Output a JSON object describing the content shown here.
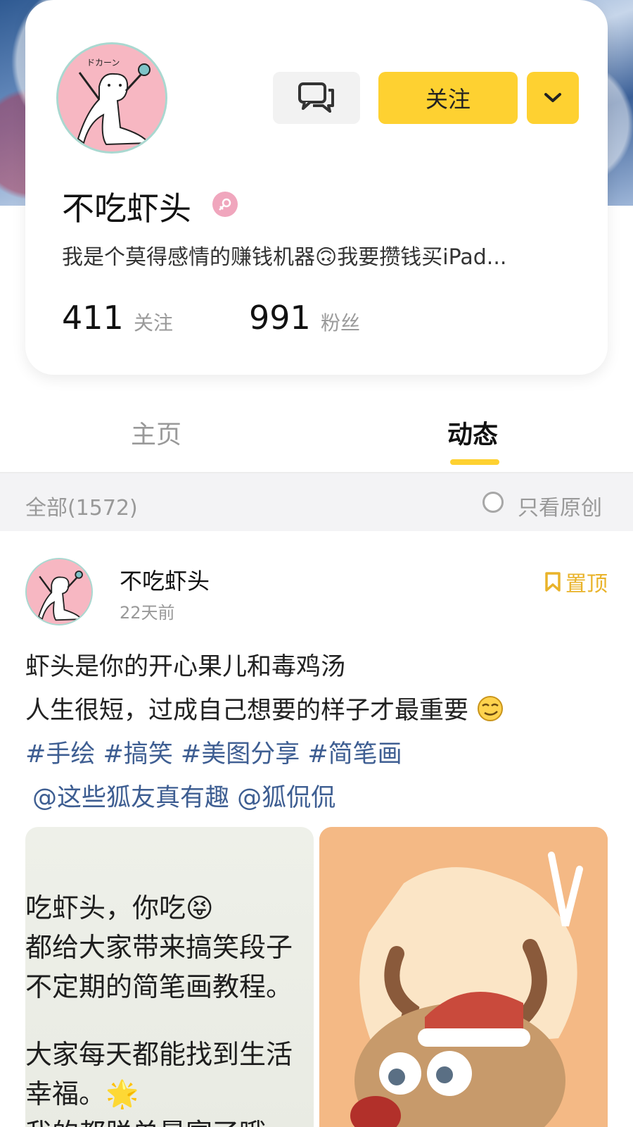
{
  "profile": {
    "name": "不吃虾头",
    "bio": "我是个莫得感情的赚钱机器🙃我要攒钱买iPad...",
    "follow_label": "关注",
    "following_count": "411",
    "following_label": "关注",
    "followers_count": "991",
    "followers_label": "粉丝"
  },
  "tabs": [
    {
      "label": "主页",
      "active": false
    },
    {
      "label": "动态",
      "active": true
    }
  ],
  "filter": {
    "all_label": "全部(1572)",
    "original_only_label": "只看原创"
  },
  "post": {
    "author": "不吃虾头",
    "time": "22天前",
    "pinned_label": "置顶",
    "line1": "虾头是你的开心果儿和毒鸡汤",
    "line2": "人生很短，过成自己想要的样子才最重要",
    "tags": "#手绘 #搞笑 #美图分享 #简笔画",
    "mentions": "@这些狐友真有趣 @狐侃侃",
    "image1_lines": [
      "吃虾头，你吃😝",
      "都给大家带来搞笑段子",
      "不定期的简笔画教程。",
      "大家每天都能找到生活",
      "幸福。🌟",
      "我的都脱单暴富了哦"
    ]
  },
  "colors": {
    "accent": "#fed131",
    "link": "#3e5e92",
    "pin": "#e9b32a"
  }
}
